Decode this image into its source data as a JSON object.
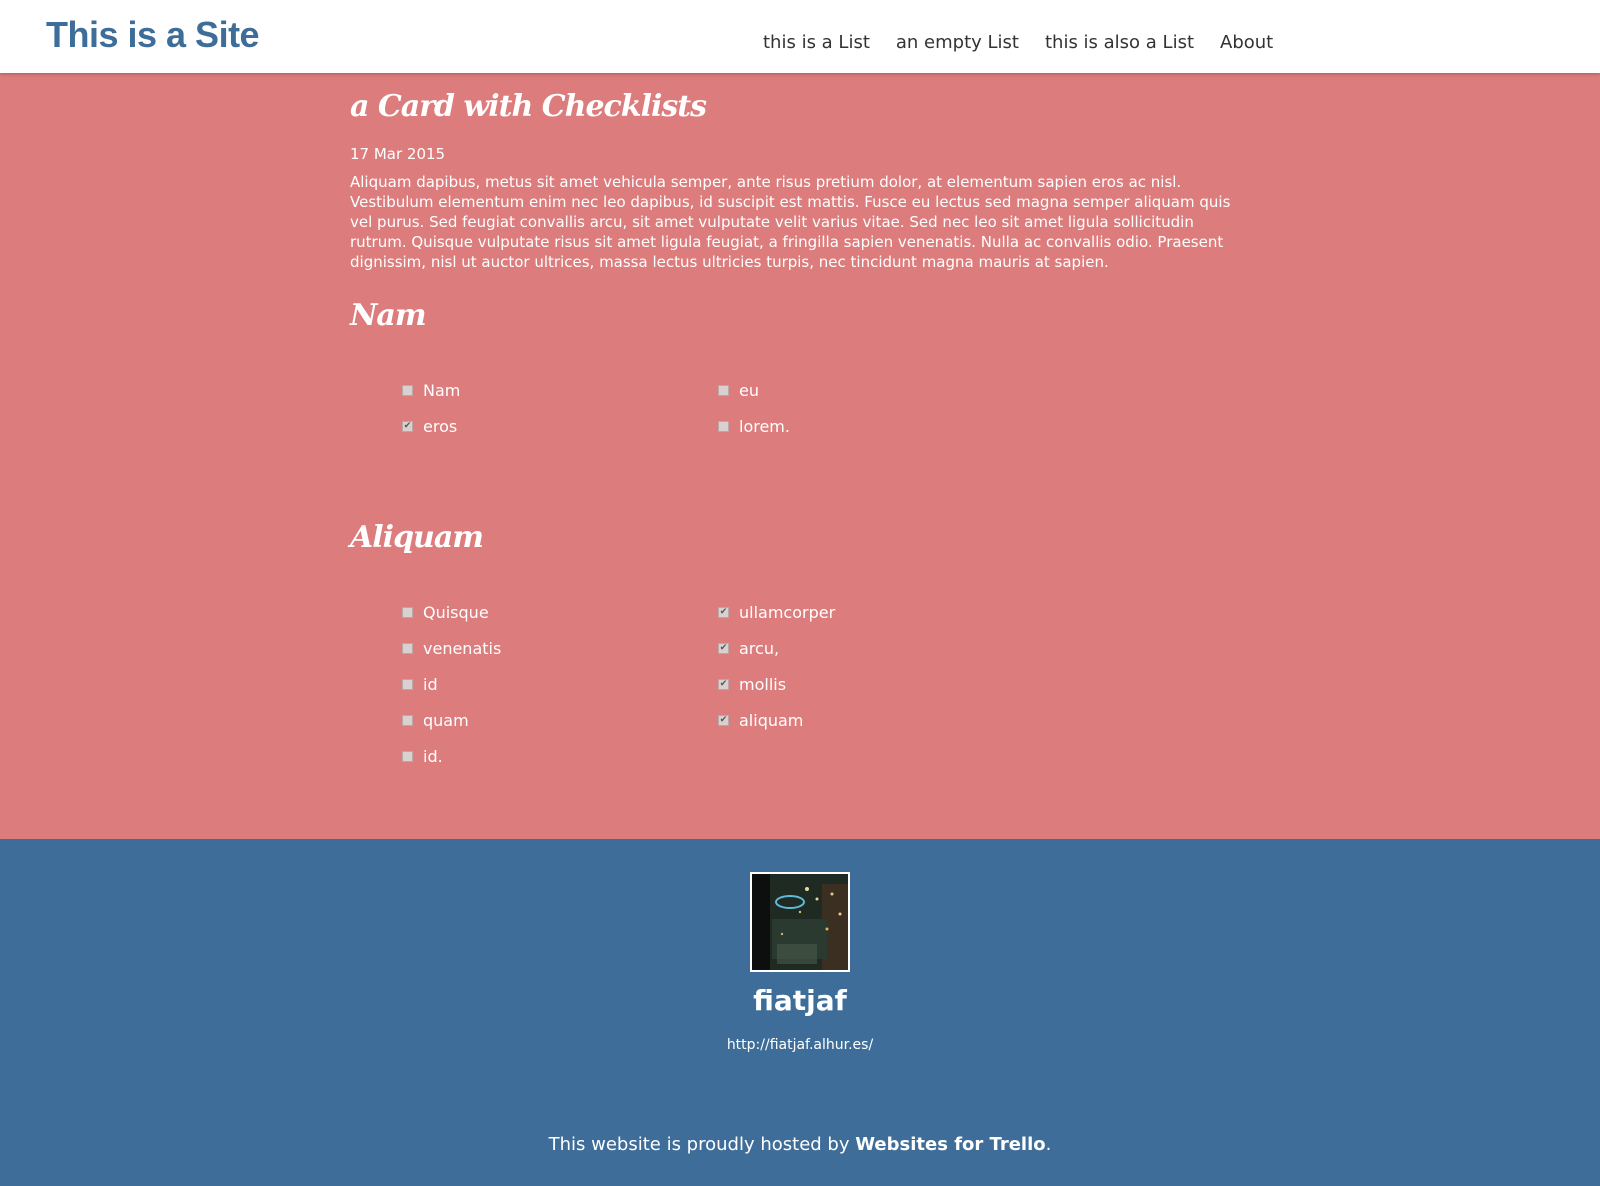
{
  "header": {
    "site_title": "This is a Site",
    "nav": [
      "this is a List",
      "an empty List",
      "this is also a List",
      "About"
    ]
  },
  "card": {
    "title": "a Card with Checklists",
    "date": "17 Mar 2015",
    "description": "Aliquam dapibus, metus sit amet vehicula semper, ante risus pretium dolor, at elementum sapien eros ac nisl. Vestibulum elementum enim nec leo dapibus, id suscipit est mattis. Fusce eu lectus sed magna semper aliquam quis vel purus. Sed feugiat convallis arcu, sit amet vulputate velit varius vitae. Sed nec leo sit amet ligula sollicitudin rutrum. Quisque vulputate risus sit amet ligula feugiat, a fringilla sapien venenatis. Nulla ac convallis odio. Praesent dignissim, nisl ut auctor ultrices, massa lectus ultricies turpis, nec tincidunt magna mauris at sapien.",
    "checklists": [
      {
        "title": "Nam",
        "items": [
          {
            "label": "Nam",
            "checked": false
          },
          {
            "label": "eros",
            "checked": true
          },
          {
            "label": "eu",
            "checked": false
          },
          {
            "label": "lorem.",
            "checked": false
          }
        ]
      },
      {
        "title": "Aliquam",
        "items": [
          {
            "label": "Quisque",
            "checked": false
          },
          {
            "label": "venenatis",
            "checked": false
          },
          {
            "label": "id",
            "checked": false
          },
          {
            "label": "quam",
            "checked": false
          },
          {
            "label": "id.",
            "checked": false
          },
          {
            "label": "ullamcorper",
            "checked": true
          },
          {
            "label": "arcu,",
            "checked": true
          },
          {
            "label": "mollis",
            "checked": true
          },
          {
            "label": "aliquam",
            "checked": true
          }
        ]
      }
    ]
  },
  "footer": {
    "author_name": "fiatjaf",
    "author_url": "http://fiatjaf.alhur.es/",
    "hosted_prefix": "This website is proudly hosted by ",
    "hosted_link": "Websites for Trello",
    "hosted_suffix": "."
  },
  "colors": {
    "header_bg": "#ffffff",
    "brand_blue": "#3d6d98",
    "card_bg": "#dc7c7c"
  }
}
